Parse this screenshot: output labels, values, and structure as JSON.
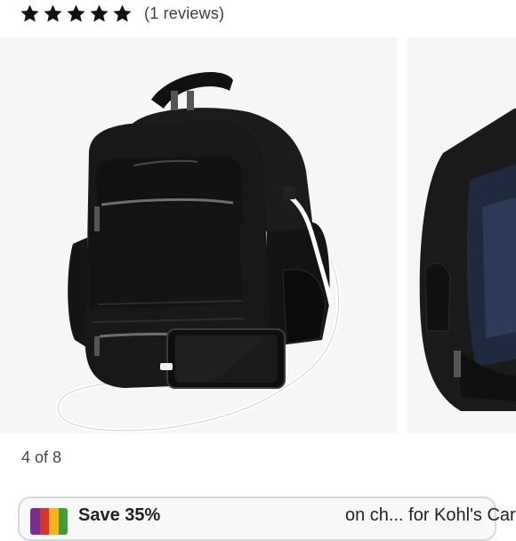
{
  "rating": {
    "stars": 5,
    "review_count_text": "(1 reviews)"
  },
  "gallery": {
    "current_index": 4,
    "total": 8,
    "counter_text": "4 of 8",
    "main_image_alt": "Black laptop backpack with USB charging cable and smartphone",
    "next_image_alt": "Black backpack opened showing blue interior"
  },
  "promo": {
    "lead_text": "Save 35%",
    "card_text": "on ch... for Kohl's Card*",
    "card_colors": [
      "#7a2f8f",
      "#d9342b",
      "#f2b51c",
      "#3f9e3a"
    ]
  },
  "colors": {
    "star": "#111111",
    "image_background": "#f6f6f6"
  }
}
